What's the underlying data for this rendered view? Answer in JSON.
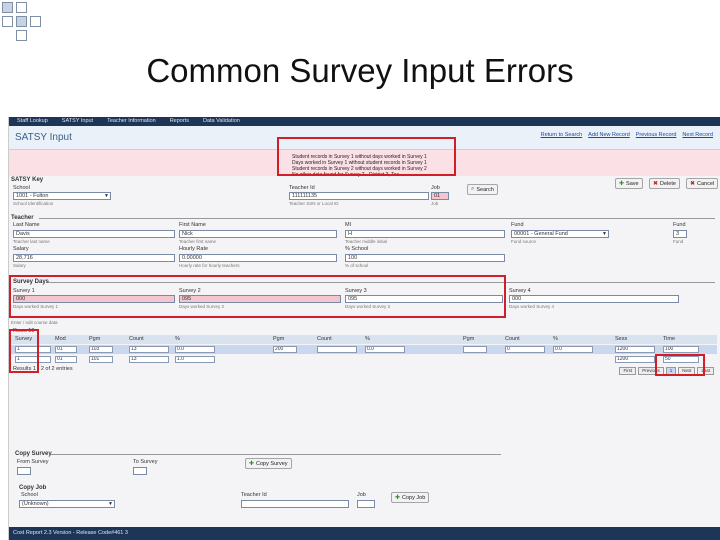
{
  "slide": {
    "title": "Common Survey Input Errors"
  },
  "app": {
    "nav_tabs": [
      "Staff Lookup",
      "SATSY Input",
      "Teacher Information",
      "Reports",
      "Data Validation"
    ],
    "page_title": "SATSY Input",
    "header_links": [
      "Return to Search",
      "Add New Record",
      "Previous Record",
      "Next Record"
    ],
    "errors": [
      "Student records in Survey 1 without days worked in Survey 1",
      "Days worked in Survey 1 without student records in Survey 1",
      "Student records in Survey 2 without days worked in Survey 2",
      "No other data found for Survey 2 - District 3, Tea..."
    ]
  },
  "key": {
    "section": "SATSY Key",
    "school_label": "School",
    "school_value": "1001 - Fulton",
    "school_hint": "School Identification",
    "teacher_id_label": "Teacher Id",
    "teacher_id_value": "111111135",
    "teacher_id_hint": "Teacher SSN or Local ID",
    "job_label": "Job",
    "job_value": "01",
    "job_hint": "Job",
    "search_label": "Search",
    "save_label": "Save",
    "delete_label": "Delete",
    "cancel_label": "Cancel"
  },
  "teacher": {
    "section": "Teacher",
    "last_name_label": "Last Name",
    "last_name_value": "Davis",
    "last_name_hint": "Teacher last name",
    "first_name_label": "First Name",
    "first_name_value": "Nick",
    "first_name_hint": "Teacher first name",
    "mi_label": "MI",
    "mi_value": "H",
    "mi_hint": "Teacher middle initial",
    "fund_label": "Fund",
    "fund_value": "00001 - General Fund",
    "fund_hint": "Fund source",
    "fund_code_label": "Fund",
    "fund_code_value": "3",
    "fund_code_hint": "Fund",
    "salary_label": "Salary",
    "salary_value": "28,716",
    "salary_hint": "Salary",
    "hourly_rate_label": "Hourly Rate",
    "hourly_rate_value": "0.00000",
    "hourly_rate_hint": "Hourly rate for hourly teachers",
    "pct_school_label": "% School",
    "pct_school_value": "100",
    "pct_school_hint": "% of school"
  },
  "survey_days": {
    "section": "Survey Days",
    "survey1_label": "Survey 1",
    "survey1_value": "000",
    "survey1_hint": "Days worked Survey 1",
    "survey2_label": "Survey 2",
    "survey2_value": "095",
    "survey2_hint": "Days worked Survey 2",
    "survey3_label": "Survey 3",
    "survey3_value": "095",
    "survey3_hint": "Days worked Survey 3",
    "survey4_label": "Survey 4",
    "survey4_value": "000",
    "survey4_hint": "Days worked Survey 4"
  },
  "grid": {
    "subheading": "Enter / edit course data",
    "rows_label": "Rows",
    "rows_per_page": "10",
    "headers": [
      "Survey",
      "Mod",
      "Pgm",
      "Count",
      "%",
      "Pgm",
      "Count",
      "%",
      "Pgm",
      "Count",
      "%",
      "Sess",
      "Time"
    ],
    "rows": [
      [
        "1",
        "01",
        "103",
        "13",
        "0.0",
        "200",
        "",
        "0.0",
        "",
        "0",
        "0.0",
        "1200",
        "100"
      ],
      [
        "1",
        "01",
        "101",
        "13",
        "1.0",
        "",
        "",
        "",
        "",
        "",
        "",
        "1200",
        "50"
      ]
    ],
    "footer": "Results 1 - 2 of 2 entries",
    "pager": [
      "First",
      "Previous",
      "1",
      "Next",
      "Last"
    ]
  },
  "copy_survey": {
    "section": "Copy Survey",
    "from_label": "From Survey",
    "to_label": "To Survey",
    "button_label": "Copy Survey"
  },
  "copy_job": {
    "section": "Copy Job",
    "school_label": "School",
    "school_value": "(Unknown)",
    "teacher_id_label": "Teacher Id",
    "job_label": "Job",
    "button_label": "Copy Job"
  },
  "footer": {
    "text": "Cost Report 2.3 Version - Release Code#461 3"
  },
  "colors": {
    "nav": "#1d3557",
    "error_bg": "#fbe0e6",
    "highlight": "#d11f2a"
  }
}
